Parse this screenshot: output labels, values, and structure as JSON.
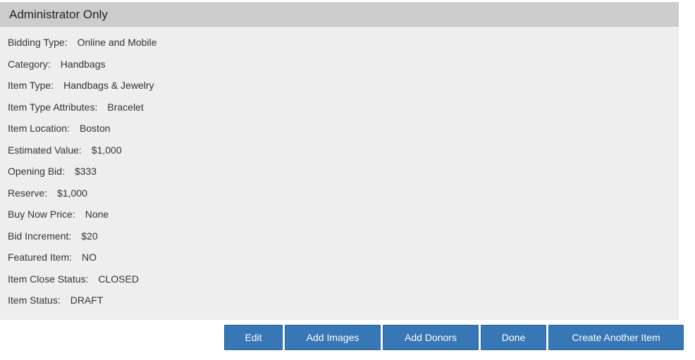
{
  "panel": {
    "title": "Administrator Only",
    "fields": [
      {
        "label": "Bidding Type:",
        "value": "Online and Mobile"
      },
      {
        "label": "Category:",
        "value": "Handbags"
      },
      {
        "label": "Item Type:",
        "value": "Handbags & Jewelry"
      },
      {
        "label": "Item Type Attributes:",
        "value": "Bracelet"
      },
      {
        "label": "Item Location:",
        "value": "Boston"
      },
      {
        "label": "Estimated Value:",
        "value": "$1,000"
      },
      {
        "label": "Opening Bid:",
        "value": "$333"
      },
      {
        "label": "Reserve:",
        "value": "$1,000"
      },
      {
        "label": "Buy Now Price:",
        "value": "None"
      },
      {
        "label": "Bid Increment:",
        "value": "$20"
      },
      {
        "label": "Featured Item:",
        "value": "NO"
      },
      {
        "label": "Item Close Status:",
        "value": "CLOSED"
      },
      {
        "label": "Item Status:",
        "value": "DRAFT"
      }
    ]
  },
  "actions": {
    "edit": "Edit",
    "add_images": "Add Images",
    "add_donors": "Add Donors",
    "done": "Done",
    "create_another": "Create Another Item"
  },
  "colors": {
    "button_bg": "#3777b5",
    "header_bg": "#cccccc",
    "panel_bg": "#eeeeee"
  }
}
